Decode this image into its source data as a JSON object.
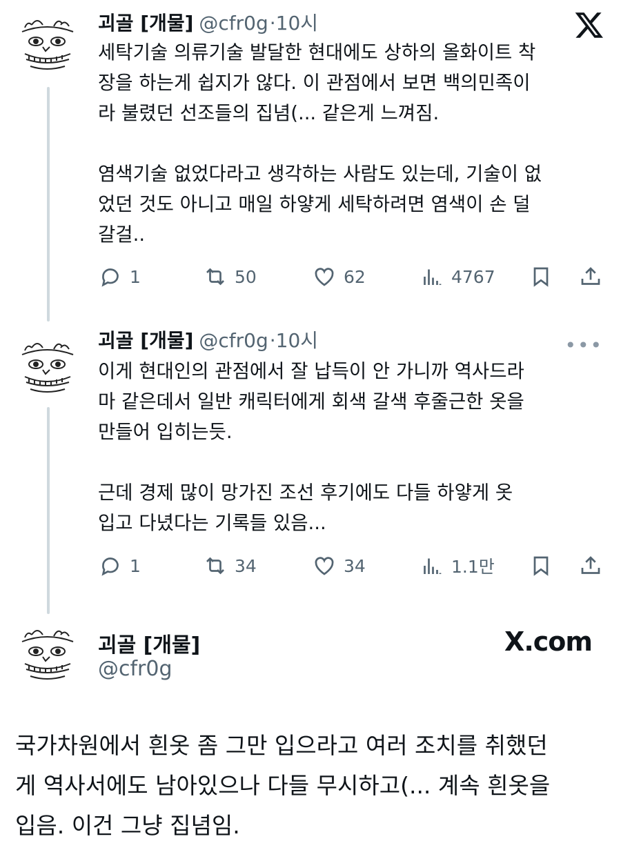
{
  "tweets": [
    {
      "name": "괴골 [개물]",
      "handle": "@cfr0g",
      "time": "·10시",
      "paragraphs": [
        [
          "세탁기술 의류기술 발달한 현대에도 상하의 올화이트 착",
          "장을 하는게 쉽지가 않다. 이 관점에서 보면 백의민족이",
          "라 불렸던 선조들의 집념(... 같은게 느껴짐."
        ],
        [
          "염색기술 없었다라고 생각하는 사람도 있는데, 기술이 없",
          "었던 것도 아니고 매일 하얗게 세탁하려면 염색이 손 덜",
          "갈걸.."
        ]
      ],
      "replies": "1",
      "reposts": "50",
      "likes": "62",
      "views": "4767"
    },
    {
      "name": "괴골 [개물]",
      "handle": "@cfr0g",
      "time": "·10시",
      "paragraphs": [
        [
          "이게 현대인의 관점에서 잘 납득이 안 가니까 역사드라",
          "마 같은데서 일반 캐릭터에게 회색 갈색 후줄근한 옷을",
          "만들어 입히는듯."
        ],
        [
          "근데 경제 많이 망가진 조선 후기에도 다들 하얗게 옷",
          "입고 다녔다는 기록들 있음..."
        ]
      ],
      "replies": "1",
      "reposts": "34",
      "likes": "34",
      "views": "1.1만"
    }
  ],
  "card": {
    "name": "괴골 [개물]",
    "handle": "@cfr0g",
    "site": "X.com",
    "lines": [
      "국가차원에서 흰옷 좀 그만 입으라고 여러 조치를 취했던",
      "게 역사서에도 남아있으나 다들 무시하고(... 계속 흰옷을",
      "입음. 이건 그냥 집념임."
    ]
  },
  "icons": {
    "top_right": "x-logo-icon",
    "more": "more-dots-icon",
    "reply": "reply-icon",
    "repost": "repost-icon",
    "like": "heart-icon",
    "views": "views-icon",
    "bookmark": "bookmark-icon",
    "share": "share-icon"
  },
  "colors": {
    "text": "#0f1419",
    "muted": "#536471",
    "thread_line": "#cfd9de"
  }
}
